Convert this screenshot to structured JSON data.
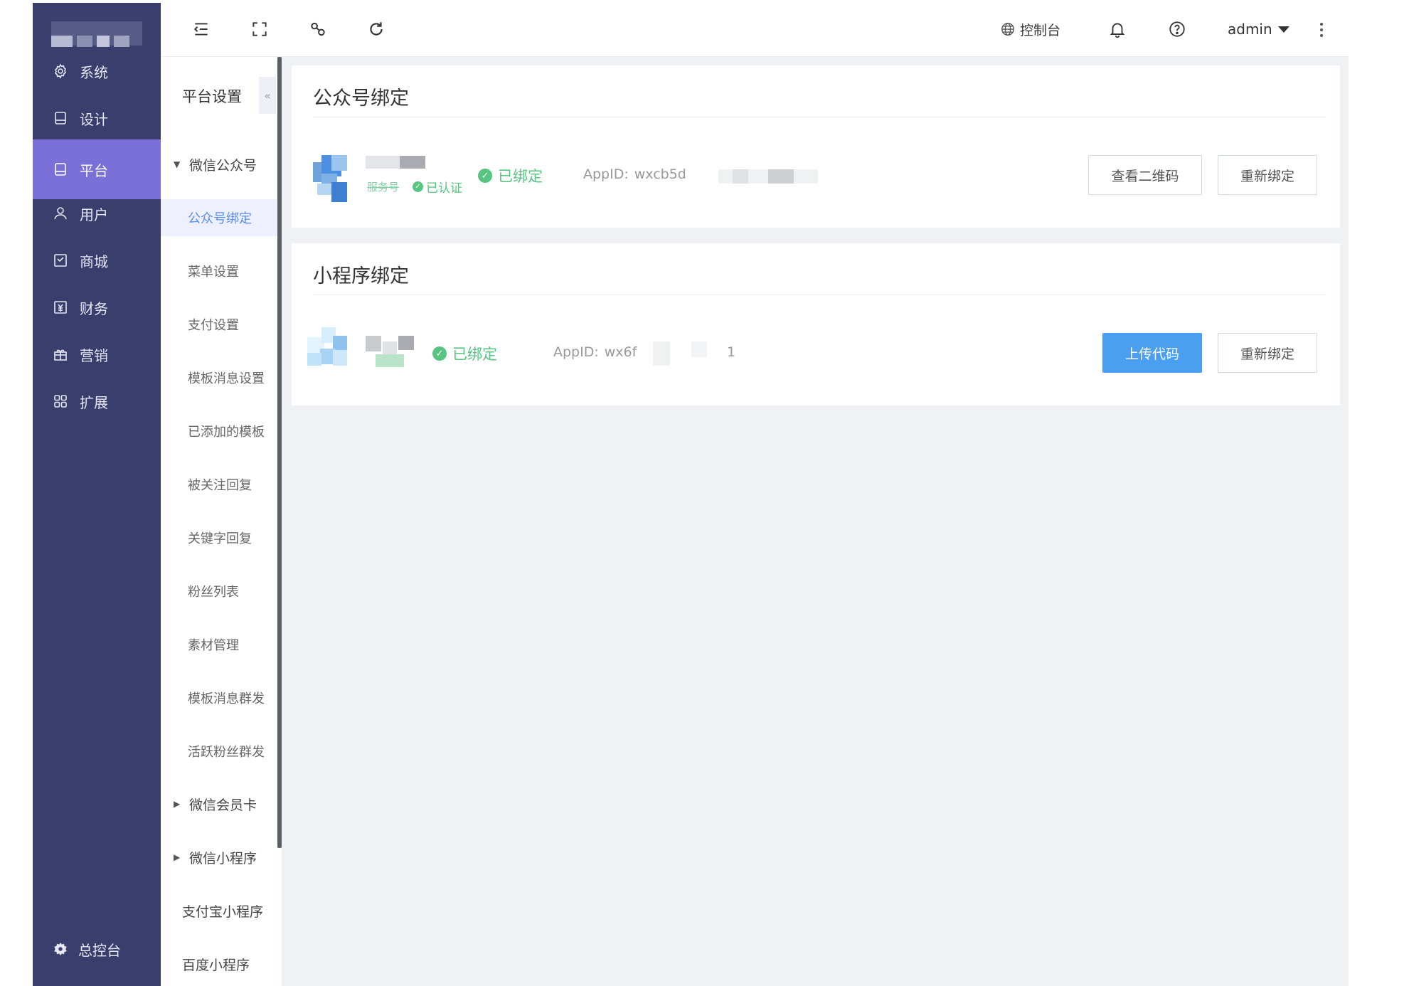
{
  "sidebar": {
    "items": [
      {
        "label": "系统",
        "icon": "gear-icon"
      },
      {
        "label": "设计",
        "icon": "design-icon"
      },
      {
        "label": "平台",
        "icon": "platform-icon"
      },
      {
        "label": "用户",
        "icon": "user-icon"
      },
      {
        "label": "商城",
        "icon": "mall-icon"
      },
      {
        "label": "财务",
        "icon": "finance-icon"
      },
      {
        "label": "营销",
        "icon": "gift-icon"
      },
      {
        "label": "扩展",
        "icon": "apps-icon"
      }
    ],
    "active_index": 2,
    "bottom_label": "总控台",
    "bottom_icon": "settings-icon"
  },
  "submenu": {
    "header": "平台设置",
    "groups": {
      "wechat_oa": "微信公众号",
      "member_card": "微信会员卡",
      "mini_program": "微信小程序"
    },
    "wechat_oa_items": [
      "公众号绑定",
      "菜单设置",
      "支付设置",
      "模板消息设置",
      "已添加的模板",
      "被关注回复",
      "关键字回复",
      "粉丝列表",
      "素材管理",
      "模板消息群发",
      "活跃粉丝群发"
    ],
    "active_item": "公众号绑定",
    "plain_items": [
      "支付宝小程序",
      "百度小程序"
    ]
  },
  "topbar": {
    "console_label": "控制台",
    "user_name": "admin",
    "icons": [
      "menu-toggle-icon",
      "fullscreen-icon",
      "link-icon",
      "refresh-icon",
      "globe-icon",
      "bell-icon",
      "help-icon",
      "more-icon"
    ]
  },
  "oa_card": {
    "title": "公众号绑定",
    "account_type": "服务号",
    "verified_label": "已认证",
    "status": "已绑定",
    "appid_label": "AppID:",
    "appid_value": "wxcb5d",
    "buttons": {
      "view_qr": "查看二维码",
      "rebind": "重新绑定"
    }
  },
  "mp_card": {
    "title": "小程序绑定",
    "status": "已绑定",
    "appid_label": "AppID:",
    "appid_value": "wx6f",
    "appid_suffix": "1",
    "buttons": {
      "upload": "上传代码",
      "rebind": "重新绑定"
    }
  },
  "colors": {
    "sidebar_bg": "#393e6c",
    "sidebar_active": "#7b70d8",
    "accent_blue": "#4a9ff0",
    "success_green": "#57c482",
    "content_bg": "#f0f1f4"
  }
}
